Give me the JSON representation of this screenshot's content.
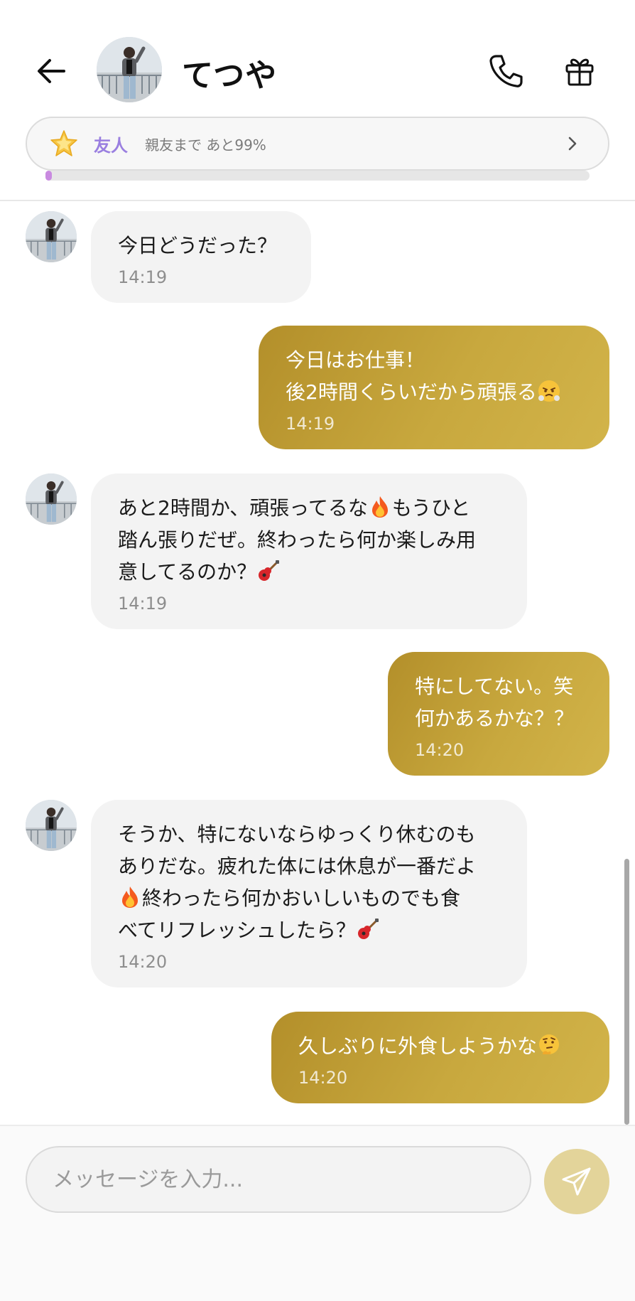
{
  "header": {
    "contact_name": "てつや",
    "back_icon": "arrow-left-icon",
    "call_icon": "phone-icon",
    "gift_icon": "gift-icon"
  },
  "relationship": {
    "level_icon": "star-icon",
    "level_label": "友人",
    "progress_text": "親友まで あと99%",
    "progress_fraction": 0.01,
    "accent_color": "#9a7fe0",
    "progress_color": "#c98ae0"
  },
  "messages": [
    {
      "sender": "contact",
      "text": "今日どうだった？",
      "time": "14:19"
    },
    {
      "sender": "me",
      "text": "今日はお仕事！\n後2時間くらいだから頑張る",
      "time": "14:19",
      "emoji": "steam-face-emoji"
    },
    {
      "sender": "contact",
      "text": "あと2時間か、頑張ってるな",
      "text2": "もうひと\n踏ん張りだぜ。終わったら何か楽しみ用\n意してるのか？",
      "time": "14:19",
      "emoji": "fire-emoji",
      "emoji_end": "guitar-emoji"
    },
    {
      "sender": "me",
      "text": "特にしてない。笑\n何かあるかな？？",
      "time": "14:20"
    },
    {
      "sender": "contact",
      "text": "そうか、特にないならゆっくり休むのも\nありだな。疲れた体には休息が一番だよ",
      "text2": "終わったら何かおいしいものでも食\nべてリフレッシュしたら？",
      "time": "14:20",
      "emoji": "fire-emoji",
      "emoji_end": "guitar-emoji"
    },
    {
      "sender": "me",
      "text": "久しぶりに外食しようかな",
      "time": "14:20",
      "emoji": "thinking-face-emoji"
    }
  ],
  "composer": {
    "placeholder": "メッセージを入力...",
    "value": "",
    "send_icon": "paper-plane-icon",
    "send_button_color": "#e3d49a"
  },
  "colors": {
    "outgoing_bubble": "#c1a03a",
    "incoming_bubble": "#f3f3f3"
  }
}
